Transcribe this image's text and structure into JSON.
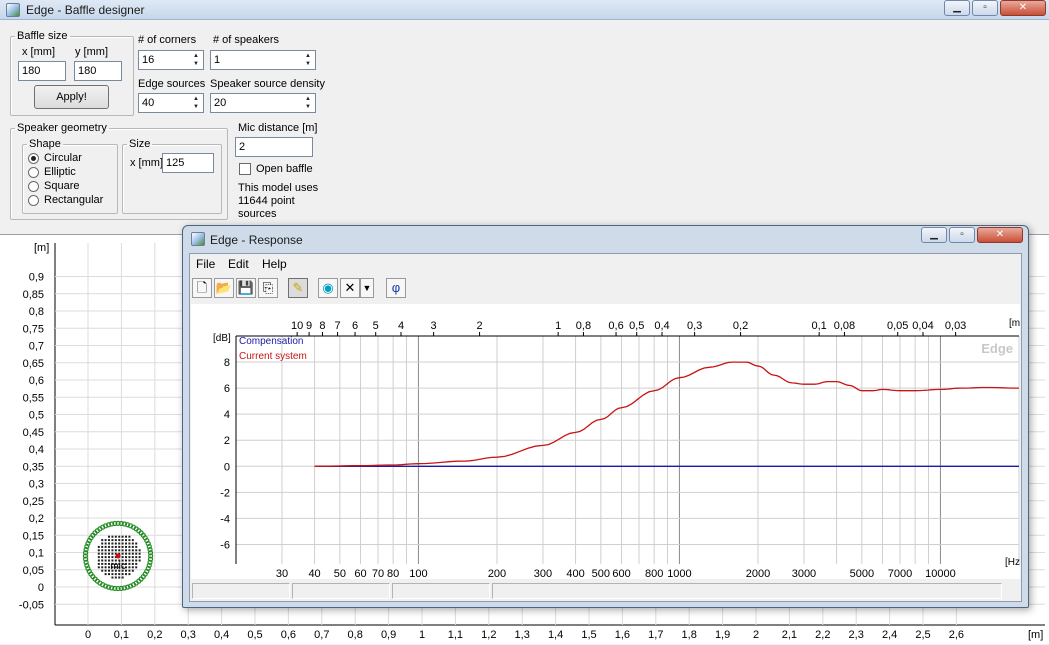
{
  "main_window": {
    "title": "Edge - Baffle designer",
    "buttons": {
      "minimize": "▁",
      "maximize": "▫",
      "close": "✕"
    }
  },
  "baffle_size": {
    "legend": "Baffle size",
    "x_label": "x [mm]",
    "x_value": "180",
    "y_label": "y [mm]",
    "y_value": "180",
    "apply_label": "Apply!"
  },
  "corners": {
    "label": "# of corners",
    "value": "16"
  },
  "speakers": {
    "label": "# of speakers",
    "value": "1"
  },
  "edge_sources": {
    "label": "Edge sources",
    "value": "40"
  },
  "speaker_density": {
    "label": "Speaker source density",
    "value": "20"
  },
  "speaker_geometry": {
    "legend": "Speaker geometry",
    "shape_legend": "Shape",
    "shapes": [
      "Circular",
      "Elliptic",
      "Square",
      "Rectangular"
    ],
    "selected_shape": "Circular",
    "size_legend": "Size",
    "size_x_label": "x [mm]",
    "size_x_value": "125"
  },
  "mic_distance": {
    "label": "Mic distance [m]",
    "value": "2"
  },
  "open_baffle": {
    "label": "Open baffle",
    "checked": false
  },
  "model_info": {
    "line1": "This model uses",
    "line2": "11644 point",
    "line3": "sources"
  },
  "baffle_plot": {
    "unit_y": "[m]",
    "unit_x": "[m]",
    "y_ticks": [
      "0,9",
      "0,85",
      "0,8",
      "0,75",
      "0,7",
      "0,65",
      "0,6",
      "0,55",
      "0,5",
      "0,45",
      "0,4",
      "0,35",
      "0,3",
      "0,25",
      "0,2",
      "0,15",
      "0,1",
      "0,05",
      "0",
      "-0,05"
    ],
    "x_ticks": [
      "0",
      "0,1",
      "0,2",
      "0,3",
      "0,4",
      "0,5",
      "0,6",
      "0,7",
      "0,8",
      "0,9",
      "1",
      "1,1",
      "1,2",
      "1,3",
      "1,4",
      "1,5",
      "1,6",
      "1,7",
      "1,8",
      "1,9",
      "2",
      "2,1",
      "2,2",
      "2,3",
      "2,4",
      "2,5",
      "2,6"
    ],
    "mic_label": "mic",
    "baffle_color": "#1f8a1f",
    "speaker_color": "#202020",
    "mic_color": "#d01010"
  },
  "response_window": {
    "title": "Edge - Response",
    "menu": [
      "File",
      "Edit",
      "Help"
    ],
    "toolbar_icons": [
      "new-file-icon",
      "open-folder-icon",
      "save-disk-icon",
      "copy-icon",
      "pencil-icon",
      "speaker-icon",
      "delete-x-icon",
      "dropdown-arrow-icon",
      "phi-icon"
    ],
    "phi_label": "φ",
    "watermark": "Edge",
    "statusbar_panels": [
      "",
      "",
      "",
      ""
    ]
  },
  "chart_data": {
    "type": "line",
    "xscale": "log",
    "xlabel": "[Hz]",
    "ylabel": "[dB]",
    "top_axis_label": "[m]",
    "xlim": [
      20,
      20000
    ],
    "ylim": [
      -7.5,
      10
    ],
    "grid": true,
    "legend_position": "top-left",
    "y_ticks": [
      "8",
      "6",
      "4",
      "2",
      "0",
      "-2",
      "-4",
      "-6"
    ],
    "x_ticks": [
      "30",
      "40",
      "50",
      "60",
      "70",
      "80",
      "100",
      "200",
      "300",
      "400",
      "500",
      "600",
      "800",
      "1000",
      "2000",
      "3000",
      "5000",
      "7000",
      "10000"
    ],
    "top_ticks": [
      "10",
      "9",
      "8",
      "7",
      "6",
      "5",
      "4",
      "3",
      "2",
      "1",
      "0,8",
      "0,6",
      "0,5",
      "0,4",
      "0,3",
      "0,2",
      "0,1",
      "0,08",
      "0,05",
      "0,04",
      "0,03"
    ],
    "series": [
      {
        "name": "Compensation",
        "color": "#1a1aa8",
        "x": [
          40,
          20000
        ],
        "y": [
          0,
          0
        ]
      },
      {
        "name": "Current system",
        "color": "#c81414",
        "x": [
          40,
          60,
          80,
          100,
          150,
          200,
          300,
          400,
          500,
          600,
          800,
          1000,
          1300,
          1600,
          1800,
          2000,
          2300,
          2700,
          3000,
          3300,
          3700,
          4000,
          4500,
          5000,
          5500,
          6000,
          7000,
          8000,
          10000,
          12000,
          15000,
          20000
        ],
        "y": [
          0,
          0.05,
          0.1,
          0.2,
          0.4,
          0.7,
          1.6,
          2.6,
          3.6,
          4.5,
          5.8,
          6.8,
          7.6,
          8.0,
          8.0,
          7.7,
          7.0,
          6.4,
          6.3,
          6.3,
          6.5,
          6.5,
          6.2,
          5.8,
          5.8,
          5.9,
          5.8,
          5.8,
          5.9,
          6.0,
          6.05,
          6.0
        ]
      }
    ]
  }
}
